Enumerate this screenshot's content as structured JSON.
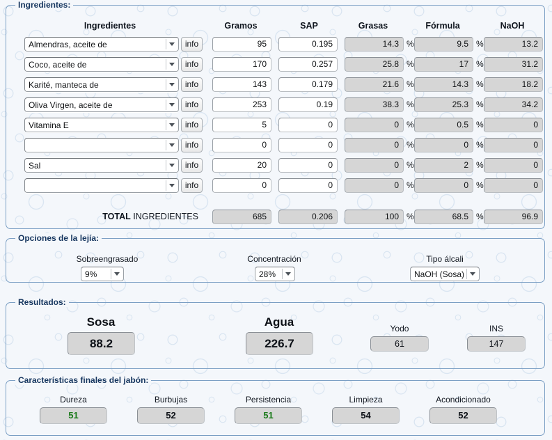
{
  "sections": {
    "ingredientes": {
      "legend": "Ingredientes:"
    },
    "lejia": {
      "legend": "Opciones de la lejía:"
    },
    "resultados": {
      "legend": "Resultados:"
    },
    "caracteristicas": {
      "legend": "Características finales del jabón:"
    }
  },
  "table": {
    "headers": {
      "ingrediente": "Ingredientes",
      "gramos": "Gramos",
      "sap": "SAP",
      "grasas": "Grasas",
      "formula": "Fórmula",
      "naoh": "NaOH"
    },
    "info_label": "info",
    "percent_symbol": "%",
    "rows": [
      {
        "ingrediente": "Almendras, aceite de",
        "gramos": "95",
        "sap": "0.195",
        "grasas": "14.3",
        "formula": "9.5",
        "naoh": "13.2"
      },
      {
        "ingrediente": "Coco, aceite de",
        "gramos": "170",
        "sap": "0.257",
        "grasas": "25.8",
        "formula": "17",
        "naoh": "31.2"
      },
      {
        "ingrediente": "Karité, manteca de",
        "gramos": "143",
        "sap": "0.179",
        "grasas": "21.6",
        "formula": "14.3",
        "naoh": "18.2"
      },
      {
        "ingrediente": "Oliva Virgen, aceite de",
        "gramos": "253",
        "sap": "0.19",
        "grasas": "38.3",
        "formula": "25.3",
        "naoh": "34.2"
      },
      {
        "ingrediente": "Vitamina E",
        "gramos": "5",
        "sap": "0",
        "grasas": "0",
        "formula": "0.5",
        "naoh": "0"
      },
      {
        "ingrediente": "",
        "gramos": "0",
        "sap": "0",
        "grasas": "0",
        "formula": "0",
        "naoh": "0"
      },
      {
        "ingrediente": "Sal",
        "gramos": "20",
        "sap": "0",
        "grasas": "0",
        "formula": "2",
        "naoh": "0"
      },
      {
        "ingrediente": "",
        "gramos": "0",
        "sap": "0",
        "grasas": "0",
        "formula": "0",
        "naoh": "0"
      }
    ],
    "total": {
      "label_bold": "TOTAL",
      "label_rest": " INGREDIENTES",
      "gramos": "685",
      "sap": "0.206",
      "grasas": "100",
      "formula": "68.5",
      "naoh": "96.9"
    }
  },
  "lejia": {
    "sobreengrasado": {
      "label": "Sobreengrasado",
      "value": "9%"
    },
    "concentracion": {
      "label": "Concentración",
      "value": "28%"
    },
    "tipo_alcali": {
      "label": "Tipo álcali",
      "value": "NaOH (Sosa)"
    }
  },
  "resultados": {
    "sosa": {
      "label": "Sosa",
      "value": "88.2"
    },
    "agua": {
      "label": "Agua",
      "value": "226.7"
    },
    "yodo": {
      "label": "Yodo",
      "value": "61"
    },
    "ins": {
      "label": "INS",
      "value": "147"
    }
  },
  "caracteristicas": [
    {
      "label": "Dureza",
      "value": "51",
      "color": "#1a7a1a"
    },
    {
      "label": "Burbujas",
      "value": "52",
      "color": "#0c1016"
    },
    {
      "label": "Persistencia",
      "value": "51",
      "color": "#1a7a1a"
    },
    {
      "label": "Limpieza",
      "value": "54",
      "color": "#0c1016"
    },
    {
      "label": "Acondicionado",
      "value": "52",
      "color": "#0c1016"
    }
  ]
}
